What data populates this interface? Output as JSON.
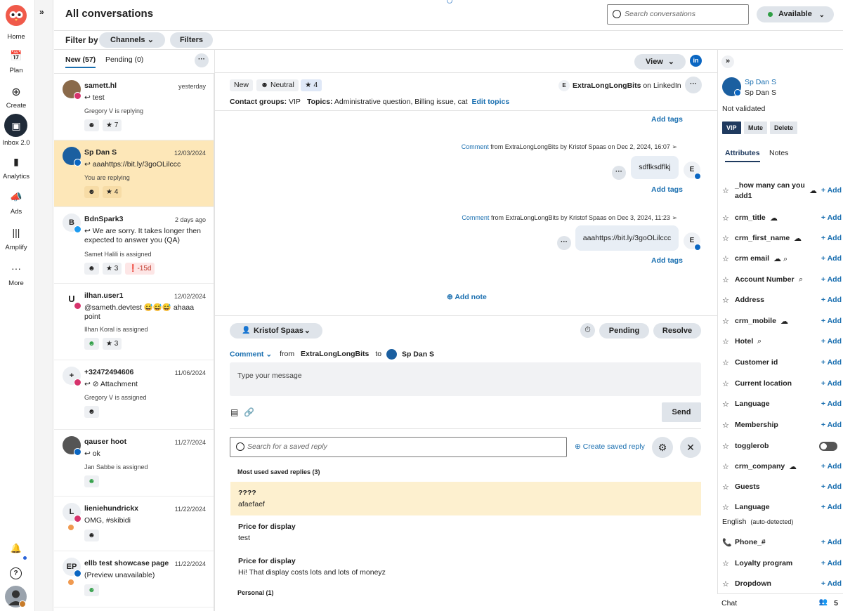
{
  "nav": {
    "home": "Home",
    "plan": "Plan",
    "create": "Create",
    "inbox": "Inbox 2.0",
    "analytics": "Analytics",
    "ads": "Ads",
    "amplify": "Amplify",
    "more": "More"
  },
  "header": {
    "title": "All conversations",
    "search_placeholder": "Search conversations",
    "status": "Available",
    "status_color": "#2e9e44"
  },
  "filter": {
    "label": "Filter by",
    "channels": "Channels",
    "filters": "Filters"
  },
  "tabs": {
    "new": "New (57)",
    "pending": "Pending (0)"
  },
  "conversations": [
    {
      "name": "samett.hl",
      "date": "yesterday",
      "message": "test",
      "assign": "Gregory V is replying",
      "chip": "7"
    },
    {
      "name": "Sp Dan S",
      "date": "12/03/2024",
      "message": "aaahttps://bit.ly/3goOLilccc",
      "assign": "You are replying",
      "chip": "4"
    },
    {
      "name": "BdnSpark3",
      "date": "2 days ago",
      "message": "We are sorry. It takes longer then expected to answer you (QA)",
      "assign": "Samet Halili is assigned",
      "chip": "3",
      "sla": "-15d",
      "initial": "B"
    },
    {
      "name": "ilhan.user1",
      "date": "12/02/2024",
      "message": "@sameth.devtest 😅😅😅 ahaaa point",
      "assign": "Ilhan Koral is assigned",
      "chip": "3"
    },
    {
      "name": "+32472494606",
      "date": "11/06/2024",
      "message": "Attachment",
      "assign": "Gregory V is assigned",
      "initial": "+"
    },
    {
      "name": "qauser hoot",
      "date": "11/27/2024",
      "message": "ok",
      "assign": "Jan Sabbe is assigned"
    },
    {
      "name": "lieniehundrickx",
      "date": "11/22/2024",
      "message": "OMG, #skibidi",
      "initial": "L"
    },
    {
      "name": "ellb test showcase page",
      "date": "11/22/2024",
      "message": "(Preview unavailable)",
      "initial": "EP"
    }
  ],
  "thread": {
    "view": "View",
    "status_tag": "New",
    "sentiment": "Neutral",
    "stars": "4",
    "account": "ExtraLongLongBits",
    "account_suffix": "on LinkedIn",
    "contact_groups_label": "Contact groups:",
    "contact_groups": "VIP",
    "topics_label": "Topics:",
    "topics": "Administrative question, Billing issue, cat",
    "edit_topics": "Edit topics",
    "add_tags": "Add tags",
    "msg1_meta_link": "Comment",
    "msg1_meta": "from ExtraLongLongBits by Kristof Spaas on Dec 2, 2024, 16:07",
    "msg1_text": "sdflksdflkj",
    "msg2_meta_link": "Comment",
    "msg2_meta": "from ExtraLongLongBits by Kristof Spaas on Dec 3, 2024, 11:23",
    "msg2_text": "aaahttps://bit.ly/3goOLilccc",
    "author_initial": "E",
    "add_note": "Add note"
  },
  "composer": {
    "assignee": "Kristof Spaas",
    "pending": "Pending",
    "resolve": "Resolve",
    "type": "Comment",
    "from_label": "from",
    "from": "ExtraLongLongBits",
    "to_label": "to",
    "to": "Sp Dan S",
    "placeholder": "Type your message",
    "send": "Send",
    "saved_search_placeholder": "Search for a saved reply",
    "create_saved": "Create saved reply",
    "most_used": "Most used saved replies (3)",
    "replies": [
      {
        "title": "????",
        "body": "afaefaef"
      },
      {
        "title": "Price for display",
        "body": "test"
      },
      {
        "title": "Price for display",
        "body": "Hi! That display costs lots and lots of moneyz"
      }
    ],
    "personal": "Personal (1)"
  },
  "contact": {
    "name": "Sp Dan S",
    "handle": "Sp Dan S",
    "validated": "Not validated",
    "vip": "VIP",
    "mute": "Mute",
    "delete": "Delete",
    "tab_attributes": "Attributes",
    "tab_notes": "Notes",
    "add": "+ Add",
    "attributes": [
      {
        "label": "_how many can you add1",
        "cloud": true
      },
      {
        "label": "crm_title",
        "cloud": true
      },
      {
        "label": "crm_first_name",
        "cloud": true
      },
      {
        "label": "crm email",
        "cloud": true,
        "search": true
      },
      {
        "label": "Account Number",
        "search": true
      },
      {
        "label": "Address"
      },
      {
        "label": "crm_mobile",
        "cloud": true
      },
      {
        "label": "Hotel",
        "search": true
      },
      {
        "label": "Customer id"
      },
      {
        "label": "Current location"
      },
      {
        "label": "Language"
      },
      {
        "label": "Membership"
      },
      {
        "label": "togglerob",
        "toggle": true
      },
      {
        "label": "crm_company",
        "cloud": true
      },
      {
        "label": "Guests"
      },
      {
        "label": "Language"
      },
      {
        "label": "Phone_#"
      },
      {
        "label": "Loyalty program"
      },
      {
        "label": "Dropdown"
      }
    ],
    "language_value": "English",
    "language_note": "(auto-detected)",
    "chat": "Chat",
    "chat_count": "5"
  }
}
